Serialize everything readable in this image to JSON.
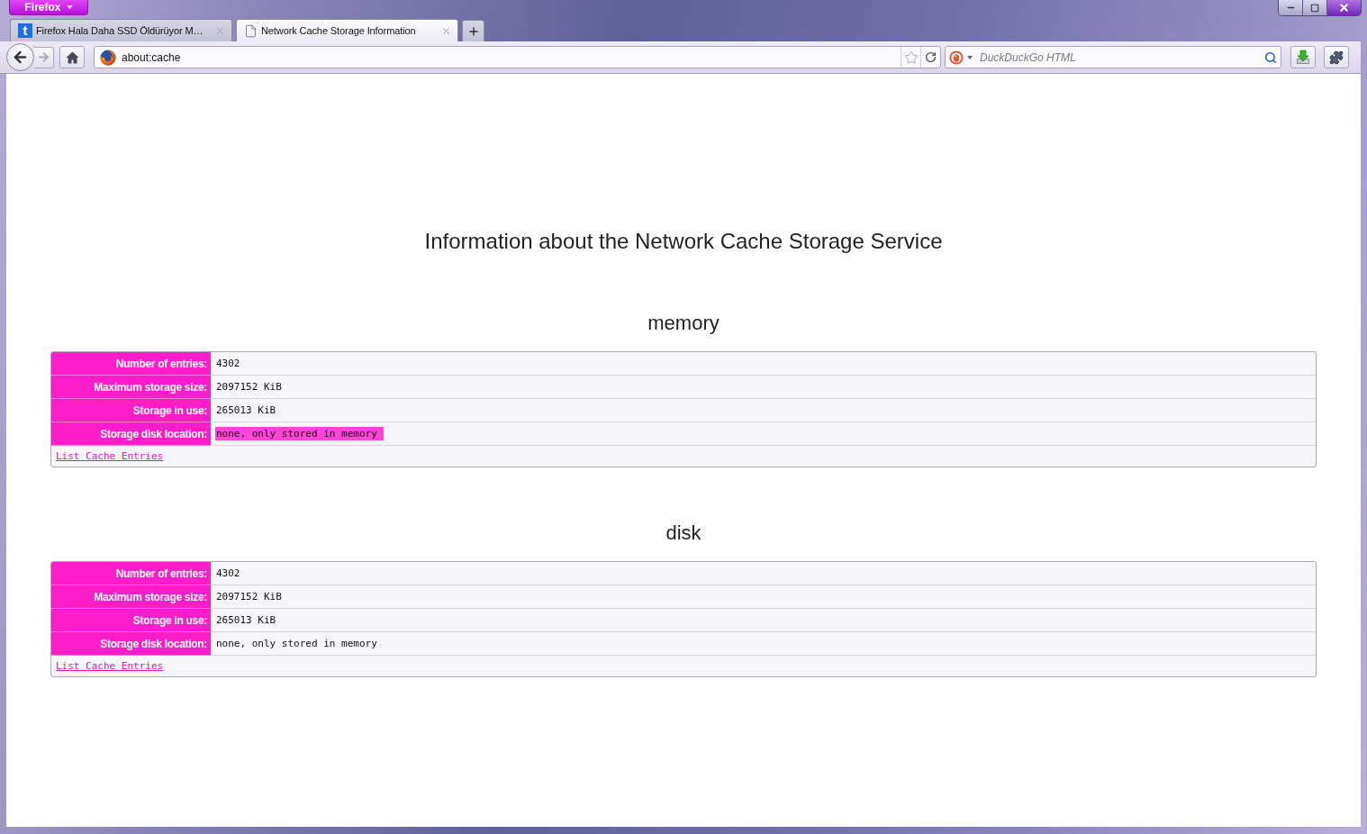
{
  "window": {
    "menu_button": "Firefox"
  },
  "tabs": [
    {
      "label": "Firefox Hala Daha SSD Öldürüyor M…",
      "kind": "site",
      "icon_text": "t",
      "selected": false
    },
    {
      "label": "Network Cache Storage Information",
      "kind": "page",
      "selected": true
    }
  ],
  "toolbar": {
    "url": "about:cache",
    "search": {
      "placeholder": "DuckDuckGo HTML"
    }
  },
  "page": {
    "title": "Information about the Network Cache Storage Service",
    "sections": [
      {
        "heading": "memory",
        "rows": [
          {
            "label": "Number of entries:",
            "value": "4302",
            "highlighted": false
          },
          {
            "label": "Maximum storage size:",
            "value": "2097152 KiB",
            "highlighted": false
          },
          {
            "label": "Storage in use:",
            "value": "265013 KiB",
            "highlighted": false
          },
          {
            "label": "Storage disk location:",
            "value": "none, only stored in memory",
            "highlighted": true
          }
        ],
        "link": "List Cache Entries"
      },
      {
        "heading": "disk",
        "rows": [
          {
            "label": "Number of entries:",
            "value": "4302",
            "highlighted": false
          },
          {
            "label": "Maximum storage size:",
            "value": "2097152 KiB",
            "highlighted": false
          },
          {
            "label": "Storage in use:",
            "value": "265013 KiB",
            "highlighted": false
          },
          {
            "label": "Storage disk location:",
            "value": "none, only stored in memory",
            "highlighted": false
          }
        ],
        "link": "List Cache Entries"
      }
    ]
  }
}
